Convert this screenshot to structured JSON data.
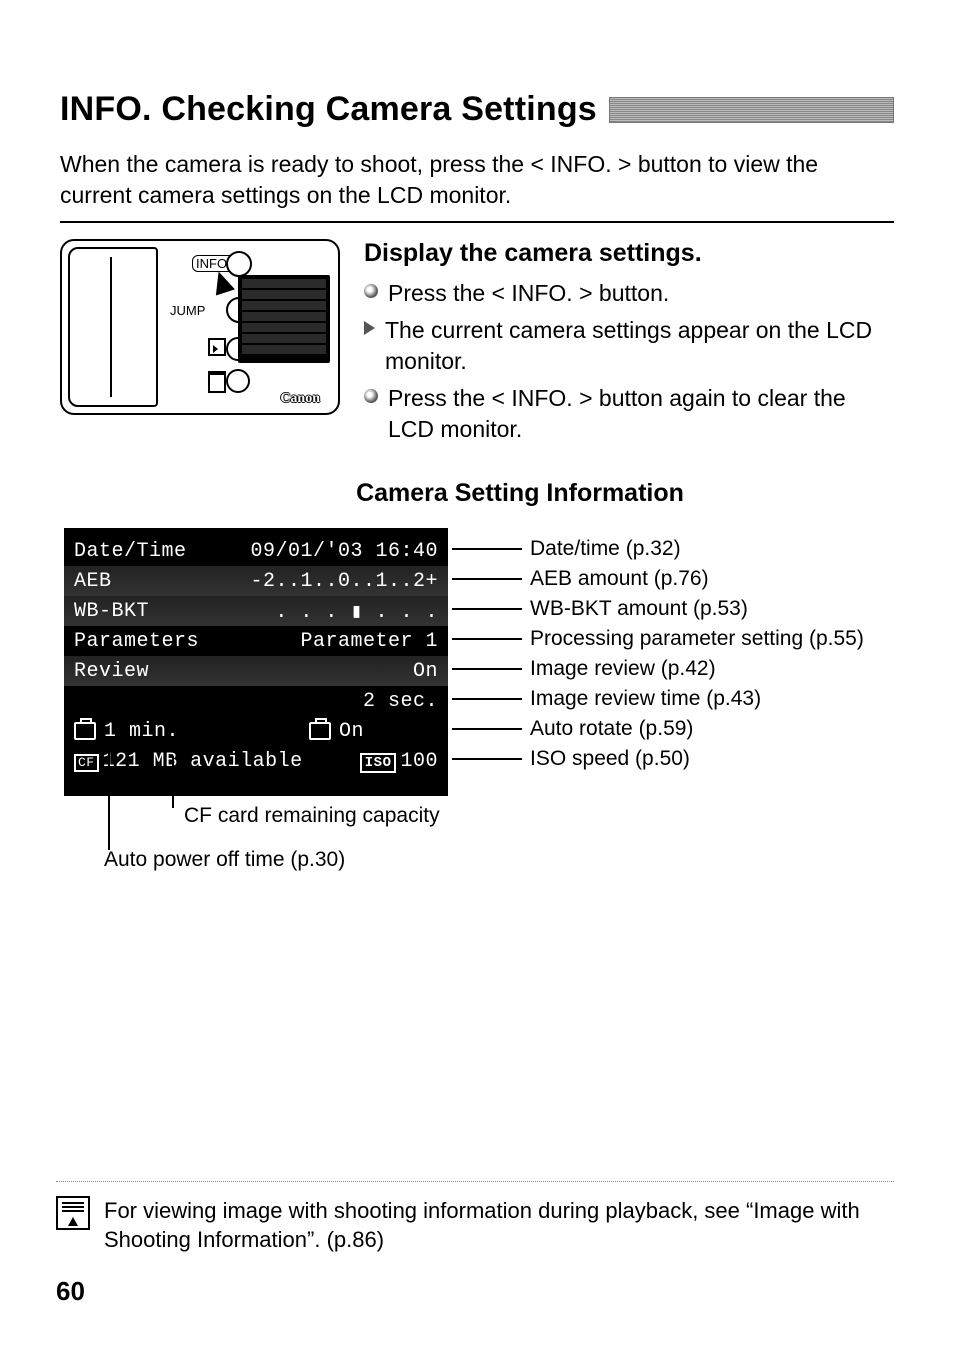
{
  "title_prefix": "INFO.",
  "title_rest": " Checking Camera Settings",
  "intro": "When the camera is ready to shoot, press the < INFO. > button to view the current camera settings on the LCD monitor.",
  "camera_labels": {
    "info": "INFO.",
    "jump": "JUMP",
    "brand": "Canon"
  },
  "section1": {
    "heading": "Display the camera settings.",
    "items": [
      {
        "type": "dot",
        "text": "Press the < INFO. > button."
      },
      {
        "type": "tri",
        "text": "The current camera settings appear on the LCD monitor."
      },
      {
        "type": "dot",
        "text": "Press the < INFO. > button again to clear the LCD monitor."
      }
    ]
  },
  "csi_heading": "Camera Setting Information",
  "screen_rows": [
    {
      "label": "Date/Time",
      "value": "09/01/'03 16:40",
      "dim": false
    },
    {
      "label": "AEB",
      "value": "-2..1..0..1..2+",
      "dim": true
    },
    {
      "label": "WB-BKT",
      "value": ". . . ▮ . . .",
      "dim": true
    },
    {
      "label": "Parameters",
      "value": "Parameter 1",
      "dim": false
    },
    {
      "label": "Review",
      "value": "On",
      "dim": true
    },
    {
      "label": "",
      "value": "2 sec.",
      "dim": false
    }
  ],
  "screen_bottom1": {
    "power_off": "1 min.",
    "rotate": "On"
  },
  "screen_bottom2": {
    "cf": "121 MB available",
    "iso": "100"
  },
  "callouts_right": [
    "Date/time (p.32)",
    "AEB amount (p.76)",
    "WB-BKT amount (p.53)",
    "Processing parameter setting (p.55)",
    "Image review (p.42)",
    "Image review time (p.43)",
    "Auto rotate (p.59)",
    "ISO speed (p.50)"
  ],
  "callouts_bottom": {
    "cf": "CF card remaining capacity",
    "power": "Auto power off time (p.30)"
  },
  "icon_text": {
    "cf": "CF",
    "iso": "ISO"
  },
  "note": "For viewing image with shooting information during playback, see “Image with Shooting Information”. (p.86)",
  "page_number": "60"
}
